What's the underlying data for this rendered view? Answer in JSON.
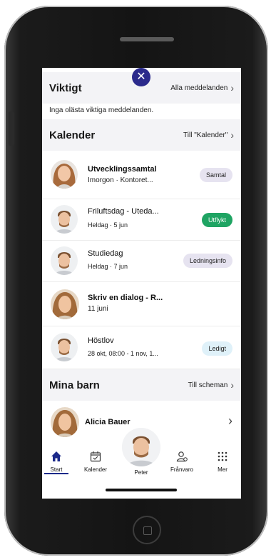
{
  "important": {
    "title": "Viktigt",
    "link": "Alla meddelanden",
    "empty_text": "Inga olästa viktiga meddelanden."
  },
  "calendar": {
    "title": "Kalender",
    "link": "Till \"Kalender\"",
    "events": [
      {
        "title": "Utvecklingssamtal",
        "subtitle": "Imorgon · Kontoret...",
        "tag": "Samtal",
        "bold": true
      },
      {
        "title": "Friluftsdag - Uteda...",
        "subtitle": "Heldag · 5 jun",
        "tag": "Utflykt",
        "bold": false
      },
      {
        "title": "Studiedag",
        "subtitle": "Heldag · 7 jun",
        "tag": "Ledningsinfo",
        "bold": false
      },
      {
        "title": "Skriv en dialog - R...",
        "subtitle": "11 juni",
        "tag": "",
        "bold": true
      },
      {
        "title": "Höstlov",
        "subtitle": "28 okt, 08:00 - 1 nov, 1...",
        "tag": "Ledigt",
        "bold": false
      }
    ]
  },
  "children": {
    "title": "Mina barn",
    "link": "Till scheman",
    "items": [
      {
        "name": "Alicia Bauer"
      }
    ]
  },
  "tabbar": {
    "tabs": [
      {
        "label": "Start",
        "icon": "home-icon",
        "active": true
      },
      {
        "label": "Kalender",
        "icon": "calendar-icon"
      },
      {
        "label": "Peter",
        "icon": "profile-avatar"
      },
      {
        "label": "Frånvaro",
        "icon": "absence-icon"
      },
      {
        "label": "Mer",
        "icon": "grid-icon"
      }
    ]
  },
  "colors": {
    "accent": "#2b2a8c",
    "utflykt": "#1fa463",
    "tab_active": "#1c2a8a"
  }
}
